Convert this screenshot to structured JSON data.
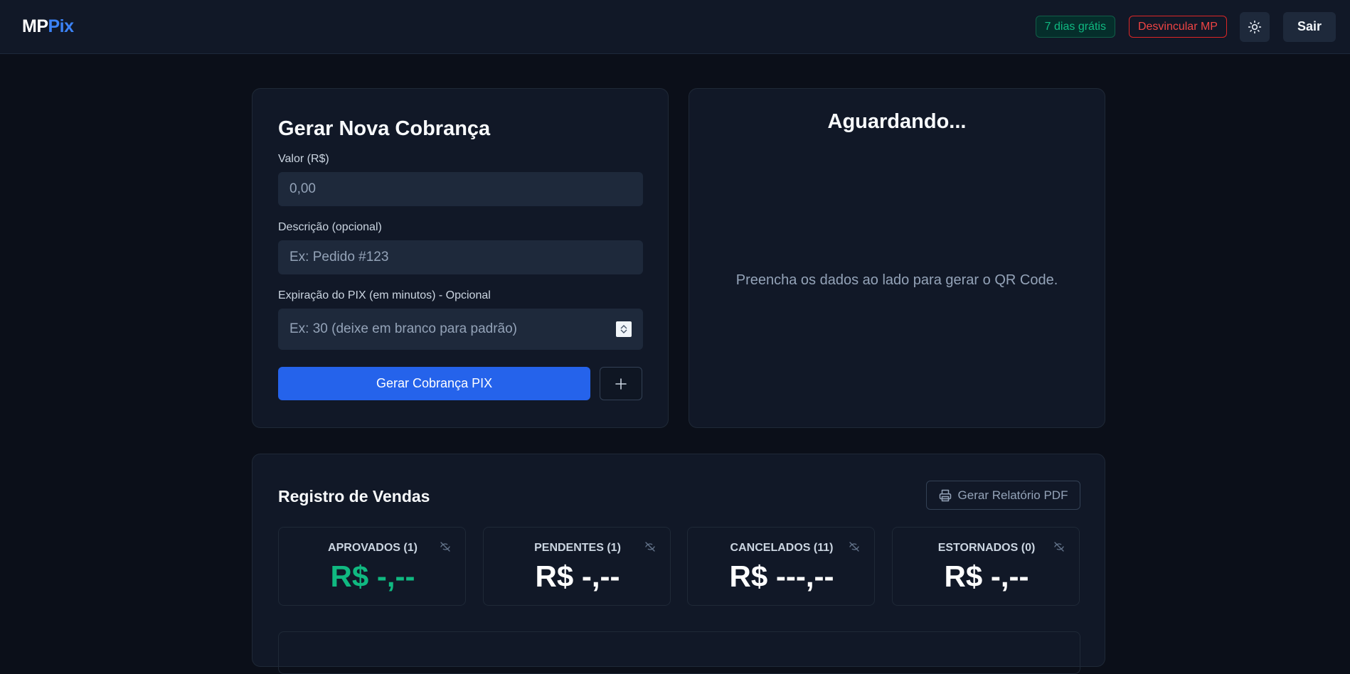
{
  "header": {
    "logo_mp": "MP",
    "logo_pix": "Pix",
    "trial_badge": "7 dias grátis",
    "unlink_label": "Desvincular MP",
    "theme_icon": "sun-icon",
    "logout_label": "Sair"
  },
  "form": {
    "title": "Gerar Nova Cobrança",
    "amount_label": "Valor (R$)",
    "amount_placeholder": "0,00",
    "description_label": "Descrição (opcional)",
    "description_placeholder": "Ex: Pedido #123",
    "expiration_label": "Expiração do PIX (em minutos) - Opcional",
    "expiration_placeholder": "Ex: 30 (deixe em branco para padrão)",
    "submit_label": "Gerar Cobrança PIX",
    "add_icon": "plus-icon"
  },
  "qr": {
    "title": "Aguardando...",
    "hint": "Preencha os dados ao lado para gerar o QR Code."
  },
  "sales": {
    "title": "Registro de Vendas",
    "report_label": "Gerar Relatório PDF",
    "report_icon": "printer-icon",
    "stats": [
      {
        "label": "APROVADOS (1)",
        "value": "R$ -,--",
        "color": "#10b981"
      },
      {
        "label": "PENDENTES (1)",
        "value": "R$ -,--",
        "color": "#ffffff"
      },
      {
        "label": "CANCELADOS (11)",
        "value": "R$ ---,--",
        "color": "#ffffff"
      },
      {
        "label": "ESTORNADOS (0)",
        "value": "R$ -,--",
        "color": "#ffffff"
      }
    ]
  },
  "colors": {
    "accent": "#2563eb",
    "success": "#10b981",
    "danger": "#ef4444",
    "background": "#0b0f19",
    "card": "#111827"
  }
}
